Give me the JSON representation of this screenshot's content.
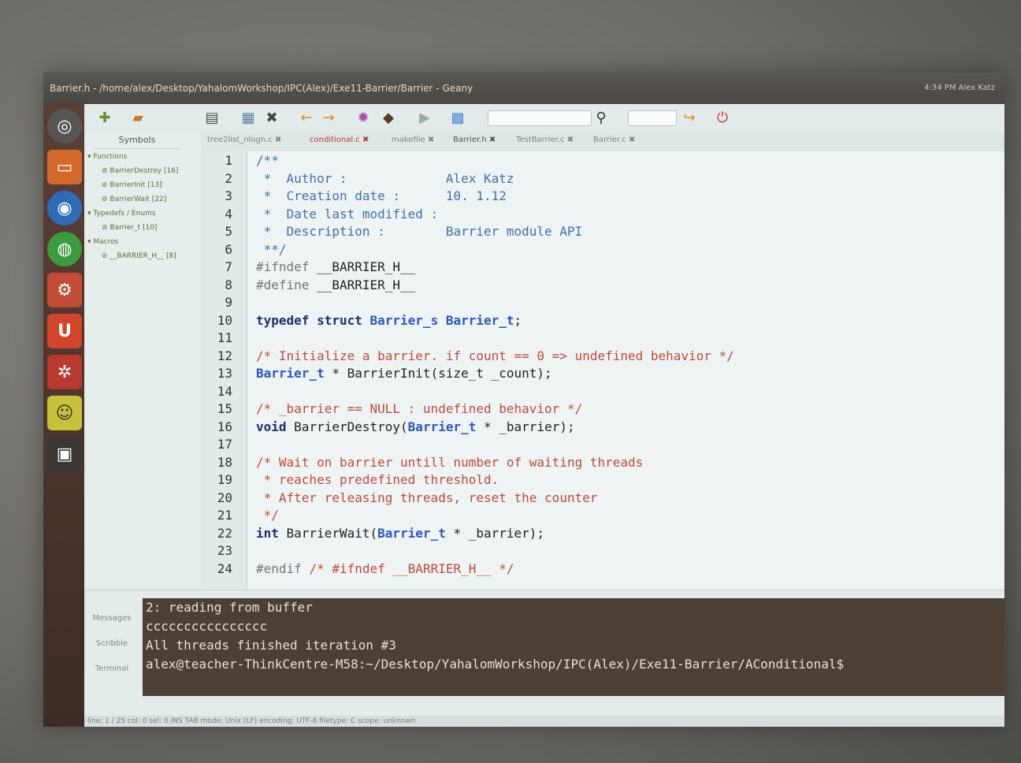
{
  "window": {
    "title": "Barrier.h - /home/alex/Desktop/YahalomWorkshop/IPC(Alex)/Exe11-Barrier/Barrier - Geany",
    "indicators": "4:34 PM   Alex Katz"
  },
  "sidebar": {
    "tab_label": "Symbols",
    "groups": [
      {
        "label": "Functions",
        "items": [
          "BarrierDestroy [16]",
          "BarrierInit [13]",
          "BarrierWait [22]"
        ]
      },
      {
        "label": "Typedefs / Enums",
        "items": [
          "Barrier_t [10]"
        ]
      },
      {
        "label": "Macros",
        "items": [
          "__BARRIER_H__ [8]"
        ]
      }
    ]
  },
  "tabs": [
    {
      "label": "tree2list_nlogn.c"
    },
    {
      "label": "conditional.c"
    },
    {
      "label": "makefile"
    },
    {
      "label": "Barrier.h"
    },
    {
      "label": "TestBarrier.c"
    },
    {
      "label": "Barrier.c"
    }
  ],
  "editor": {
    "lines": [
      {
        "n": "1",
        "parts": [
          {
            "t": "/**",
            "c": "c-doc"
          }
        ]
      },
      {
        "n": "2",
        "parts": [
          {
            "t": " *  Author :             Alex Katz",
            "c": "c-doc"
          }
        ]
      },
      {
        "n": "3",
        "parts": [
          {
            "t": " *  Creation date :      10. 1.12",
            "c": "c-doc"
          }
        ]
      },
      {
        "n": "4",
        "parts": [
          {
            "t": " *  Date last modified :",
            "c": "c-doc"
          }
        ]
      },
      {
        "n": "5",
        "parts": [
          {
            "t": " *  Description :        Barrier module API",
            "c": "c-doc"
          }
        ]
      },
      {
        "n": "6",
        "parts": [
          {
            "t": " **/",
            "c": "c-doc"
          }
        ]
      },
      {
        "n": "7",
        "parts": [
          {
            "t": "#ifndef ",
            "c": "c-pp"
          },
          {
            "t": "__BARRIER_H__",
            "c": ""
          }
        ]
      },
      {
        "n": "8",
        "parts": [
          {
            "t": "#define ",
            "c": "c-pp"
          },
          {
            "t": "__BARRIER_H__",
            "c": ""
          }
        ]
      },
      {
        "n": "9",
        "parts": [
          {
            "t": "",
            "c": ""
          }
        ]
      },
      {
        "n": "10",
        "parts": [
          {
            "t": "typedef struct ",
            "c": "c-kw"
          },
          {
            "t": "Barrier_s Barrier_t",
            "c": "c-ty"
          },
          {
            "t": ";",
            "c": ""
          }
        ]
      },
      {
        "n": "11",
        "parts": [
          {
            "t": "",
            "c": ""
          }
        ]
      },
      {
        "n": "12",
        "parts": [
          {
            "t": "/* Initialize a barrier. if count == 0 => undefined behavior */",
            "c": "c-cm"
          }
        ]
      },
      {
        "n": "13",
        "parts": [
          {
            "t": "Barrier_t",
            "c": "c-ty"
          },
          {
            "t": " * BarrierInit(size_t _count);",
            "c": ""
          }
        ]
      },
      {
        "n": "14",
        "parts": [
          {
            "t": "",
            "c": ""
          }
        ]
      },
      {
        "n": "15",
        "parts": [
          {
            "t": "/* _barrier == NULL : undefined behavior */",
            "c": "c-cm"
          }
        ]
      },
      {
        "n": "16",
        "parts": [
          {
            "t": "void ",
            "c": "c-kw"
          },
          {
            "t": "BarrierDestroy(",
            "c": ""
          },
          {
            "t": "Barrier_t",
            "c": "c-ty"
          },
          {
            "t": " * _barrier);",
            "c": ""
          }
        ]
      },
      {
        "n": "17",
        "parts": [
          {
            "t": "",
            "c": ""
          }
        ]
      },
      {
        "n": "18",
        "parts": [
          {
            "t": "/* Wait on barrier untill number of waiting threads",
            "c": "c-cm"
          }
        ]
      },
      {
        "n": "19",
        "parts": [
          {
            "t": " * reaches predefined threshold.",
            "c": "c-cm"
          }
        ]
      },
      {
        "n": "20",
        "parts": [
          {
            "t": " * After releasing threads, reset the counter",
            "c": "c-cm"
          }
        ]
      },
      {
        "n": "21",
        "parts": [
          {
            "t": " */",
            "c": "c-cm"
          }
        ]
      },
      {
        "n": "22",
        "parts": [
          {
            "t": "int ",
            "c": "c-kw"
          },
          {
            "t": "BarrierWait(",
            "c": ""
          },
          {
            "t": "Barrier_t",
            "c": "c-ty"
          },
          {
            "t": " * _barrier);",
            "c": ""
          }
        ]
      },
      {
        "n": "23",
        "parts": [
          {
            "t": "",
            "c": ""
          }
        ]
      },
      {
        "n": "24",
        "parts": [
          {
            "t": "#endif ",
            "c": "c-pp"
          },
          {
            "t": "/* #ifndef __BARRIER_H__ */",
            "c": "c-cm"
          }
        ]
      }
    ]
  },
  "bottom_panel": {
    "tabs": [
      "Messages",
      "Scribble",
      "Terminal"
    ],
    "terminal_lines": [
      "2: reading from buffer",
      "cccccccccccccccc",
      "All threads finished iteration #3",
      "alex@teacher-ThinkCentre-M58:~/Desktop/YahalomWorkshop/IPC(Alex)/Exe11-Barrier/AConditional$"
    ]
  },
  "statusbar": {
    "text": "line: 1 / 25   col: 0   sel: 0   INS   TAB   mode: Unix (LF)   encoding: UTF-8   filetype: C   scope: unknown"
  },
  "colors": {
    "comment": "#c04a3a",
    "doc_comment": "#3f6fb0",
    "type": "#2c55c9",
    "keyword": "#1d2f6e",
    "active_tab": "#c0392b",
    "terminal_bg": "#4b3f36"
  }
}
